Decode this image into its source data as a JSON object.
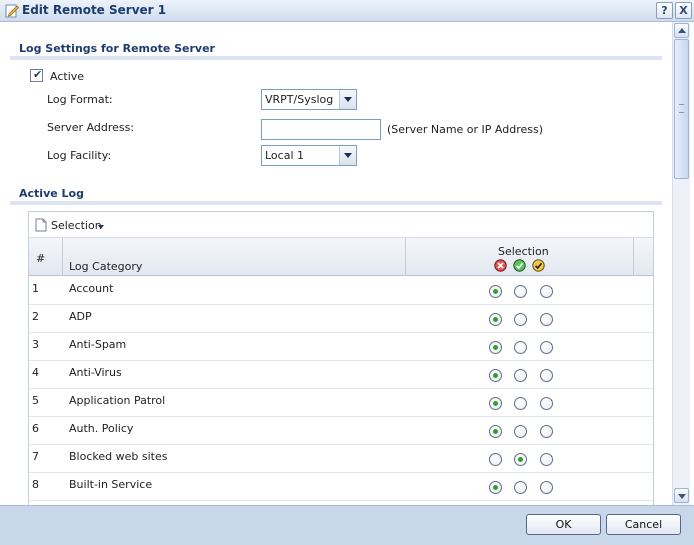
{
  "window": {
    "title": "Edit Remote Server 1",
    "help": "?",
    "close": "X"
  },
  "log_settings": {
    "heading": "Log Settings for Remote Server",
    "active_label": "Active",
    "active_checked": true,
    "log_format_label": "Log Format:",
    "log_format_value": "VRPT/Syslog",
    "server_address_label": "Server Address:",
    "server_address_value": "",
    "server_address_hint": "(Server Name or IP Address)",
    "log_facility_label": "Log Facility:",
    "log_facility_value": "Local 1"
  },
  "active_log": {
    "heading": "Active Log",
    "toolbar_label": "Selection",
    "columns": {
      "num": "#",
      "category": "Log Category",
      "selection": "Selection"
    },
    "selection_icons": [
      "disable-icon",
      "enable-normal-icon",
      "enable-debug-icon"
    ],
    "rows": [
      {
        "num": "1",
        "category": "Account",
        "selected": 0
      },
      {
        "num": "2",
        "category": "ADP",
        "selected": 0
      },
      {
        "num": "3",
        "category": "Anti-Spam",
        "selected": 0
      },
      {
        "num": "4",
        "category": "Anti-Virus",
        "selected": 0
      },
      {
        "num": "5",
        "category": "Application Patrol",
        "selected": 0
      },
      {
        "num": "6",
        "category": "Auth. Policy",
        "selected": 0
      },
      {
        "num": "7",
        "category": "Blocked web sites",
        "selected": 1
      },
      {
        "num": "8",
        "category": "Built-in Service",
        "selected": 0
      }
    ]
  },
  "footer": {
    "ok": "OK",
    "cancel": "Cancel"
  }
}
